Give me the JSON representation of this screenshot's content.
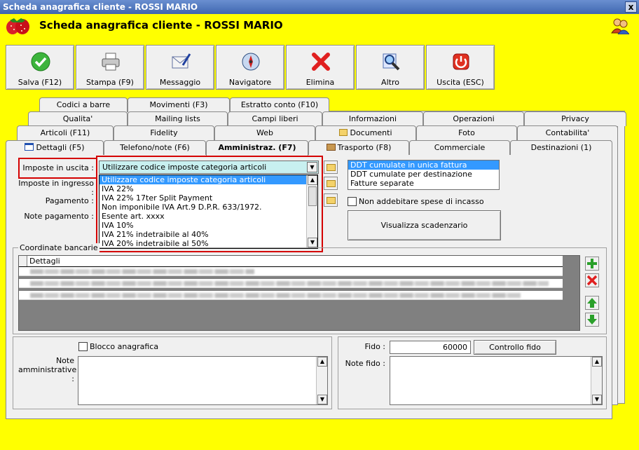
{
  "window": {
    "title": "Scheda anagrafica cliente - ROSSI MARIO",
    "close": "x"
  },
  "header": {
    "title": "Scheda anagrafica cliente - ROSSI MARIO"
  },
  "toolbar": [
    {
      "label": "Salva (F12)",
      "icon": "check-icon"
    },
    {
      "label": "Stampa (F9)",
      "icon": "printer-icon"
    },
    {
      "label": "Messaggio",
      "icon": "envelope-icon"
    },
    {
      "label": "Navigatore",
      "icon": "compass-icon"
    },
    {
      "label": "Elimina",
      "icon": "delete-x-icon"
    },
    {
      "label": "Altro",
      "icon": "magnifier-icon"
    },
    {
      "label": "Uscita (ESC)",
      "icon": "power-icon"
    }
  ],
  "tabs": {
    "row1": [
      "Codici a barre",
      "Movimenti (F3)",
      "Estratto conto (F10)"
    ],
    "row2": [
      "Qualita'",
      "Mailing lists",
      "Campi liberi",
      "Informazioni",
      "Operazioni",
      "Privacy"
    ],
    "row3": [
      "Articoli (F11)",
      "Fidelity",
      "Web",
      "Documenti",
      "Foto",
      "Contabilita'"
    ],
    "row4": [
      "Dettagli (F5)",
      "Telefono/note (F6)",
      "Amministraz. (F7)",
      "Trasporto (F8)",
      "Commerciale",
      "Destinazioni (1)"
    ],
    "active": "Amministraz. (F7)"
  },
  "form": {
    "imposte_uscita_label": "Imposte in uscita :",
    "imposte_uscita_value": "Utilizzare codice imposte categoria articoli",
    "imposte_ingresso_label": "Imposte in ingresso :",
    "pagamento_label": "Pagamento :",
    "note_pagamento_label": "Note pagamento :",
    "dropdown_options": [
      "Utilizzare codice imposte categoria articoli",
      "IVA 22%",
      "IVA 22% 17ter Split Payment",
      "Non imponibile IVA Art.9 D.P.R. 633/1972.",
      "Esente art. xxxx",
      "IVA 10%",
      "IVA 21% indetraibile al 40%",
      "IVA 20% indetraibile al 50%"
    ],
    "dropdown_selected": 0,
    "ddt_options": [
      "DDT cumulate in unica fattura",
      "DDT cumulate per destinazione",
      "Fatture separate"
    ],
    "ddt_selected": 0,
    "non_addebitare_label": "Non addebitare spese di incasso",
    "visualizza_label": "Visualizza scadenzario"
  },
  "bank": {
    "group_label": "Coordinate bancarie",
    "column": "Dettagli",
    "rows": 3
  },
  "bottom": {
    "blocco_label": "Blocco anagrafica",
    "note_amm_label": "Note amministrative :",
    "fido_label": "Fido :",
    "fido_value": "60000",
    "controllo_label": "Controllo fido",
    "note_fido_label": "Note fido :"
  },
  "colors": {
    "background": "#ffff00",
    "selection": "#3399ff",
    "highlight_box": "#d40000",
    "combo_bg": "#c8f0f0"
  }
}
